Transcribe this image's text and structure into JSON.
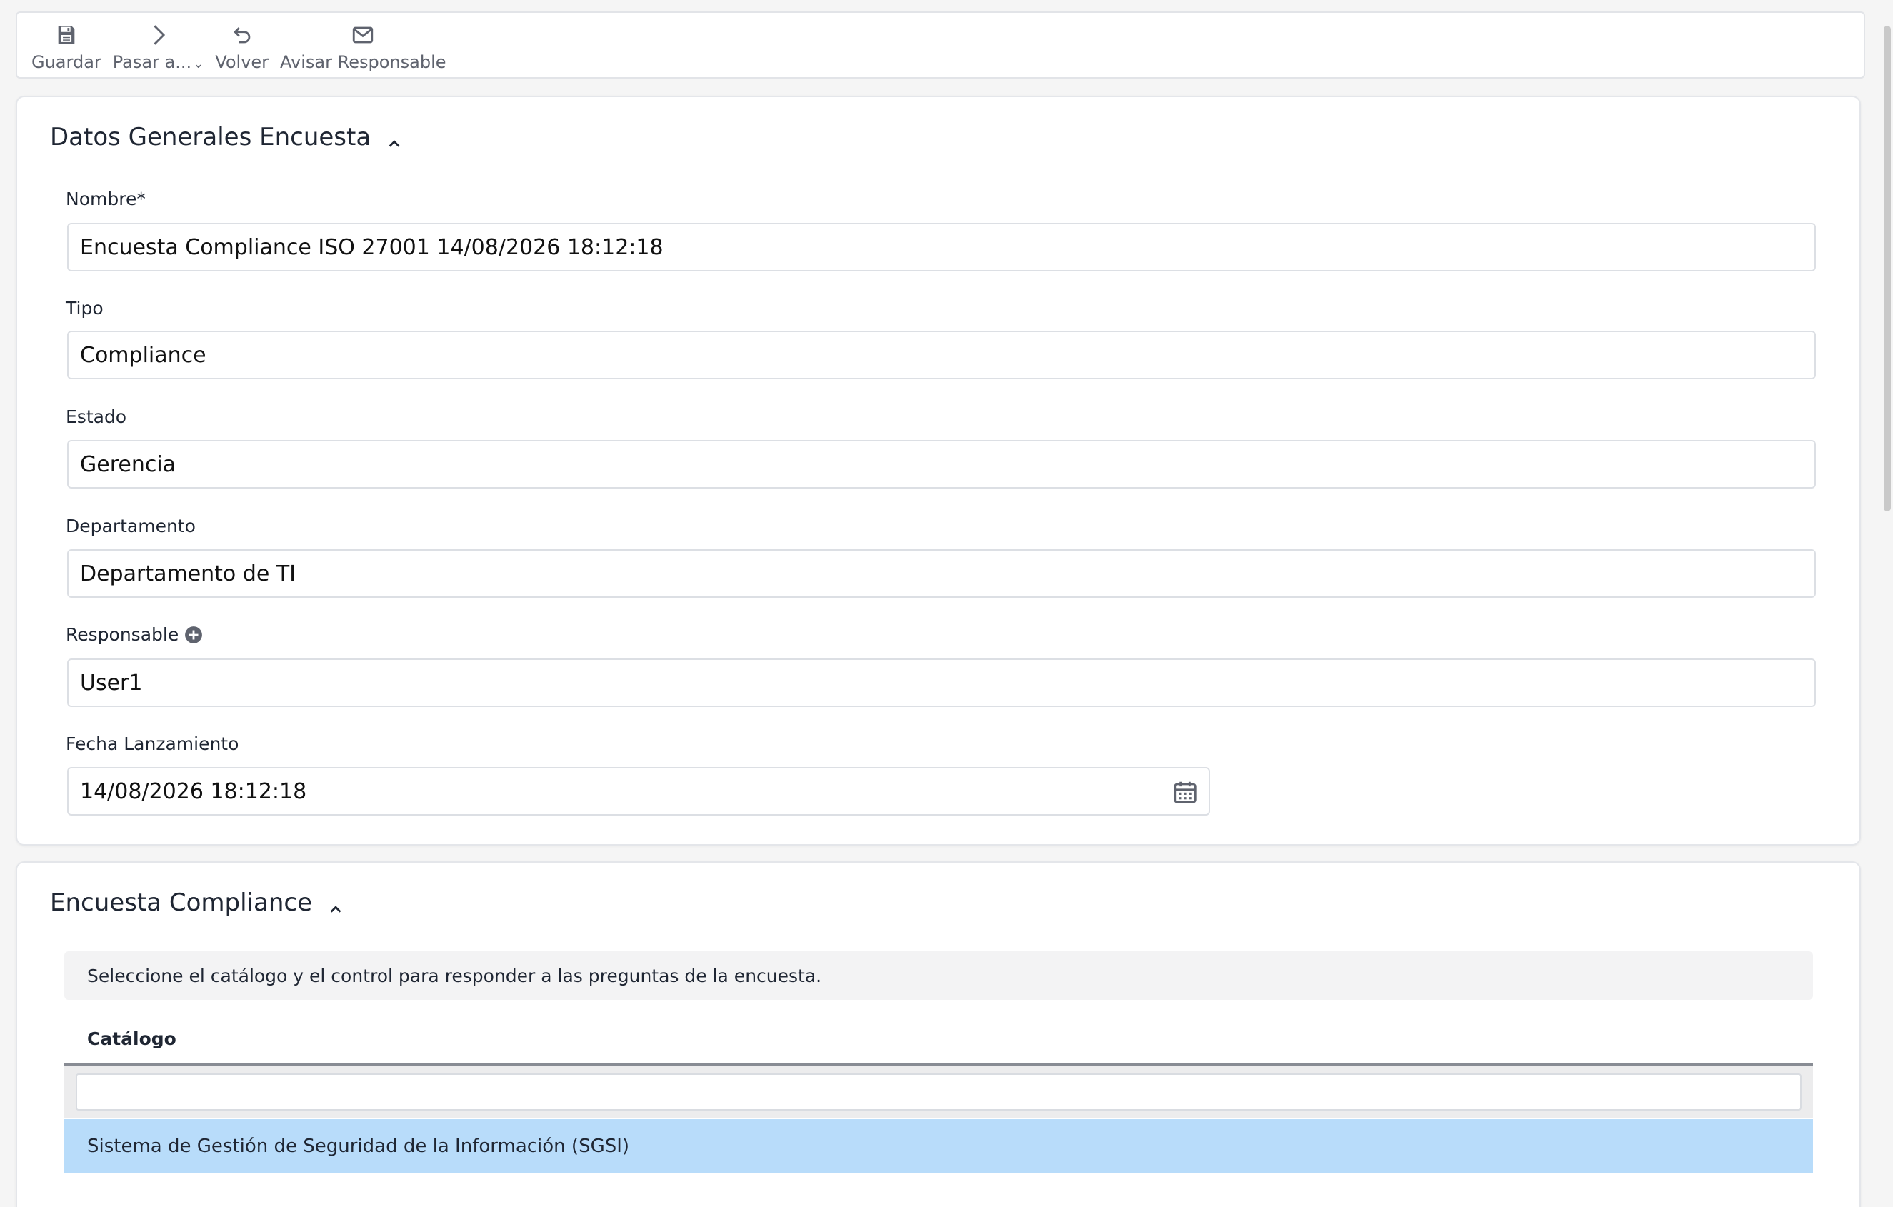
{
  "toolbar": {
    "save_label": "Guardar",
    "move_label": "Pasar a...",
    "back_label": "Volver",
    "notify_label": "Avisar Responsable"
  },
  "general": {
    "title": "Datos Generales Encuesta",
    "fields": {
      "nombre": {
        "label": "Nombre*",
        "value": "Encuesta Compliance ISO 27001 14/08/2026 18:12:18"
      },
      "tipo": {
        "label": "Tipo",
        "value": "Compliance"
      },
      "estado": {
        "label": "Estado",
        "value": "Gerencia"
      },
      "departamento": {
        "label": "Departamento",
        "value": "Departamento de TI"
      },
      "responsable": {
        "label": "Responsable",
        "value": "User1"
      },
      "fecha": {
        "label": "Fecha Lanzamiento",
        "value": "14/08/2026 18:12:18"
      }
    }
  },
  "compliance": {
    "title": "Encuesta Compliance",
    "hint": "Seleccione el catálogo y el control para responder a las preguntas de la encuesta.",
    "catalog_header": "Catálogo",
    "catalog_rows": [
      "Sistema de Gestión de Seguridad de la Información (SGSI)"
    ]
  },
  "colors": {
    "selected_row": "#b8dcfa",
    "toolbar_text": "#5f636e"
  }
}
